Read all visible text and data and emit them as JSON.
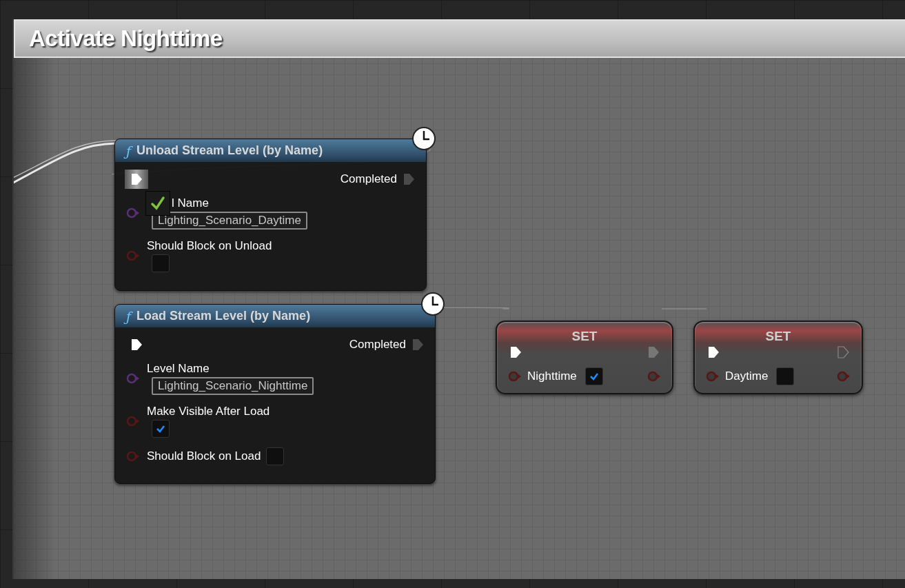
{
  "comment": {
    "title": "Activate Nighttime"
  },
  "nodes": [
    {
      "kind": "function",
      "icon": "ƒ",
      "title": "Unload Stream Level (by Name)",
      "latent": true,
      "exec_in_highlighted": true,
      "exec_out": "Completed",
      "drop_marker": true,
      "pins": [
        {
          "kind": "string",
          "label": "l Name",
          "value": "Lighting_Scenario_Daytime"
        },
        {
          "kind": "bool",
          "label": "Should Block on Unload",
          "checked": false,
          "inline": false
        }
      ]
    },
    {
      "kind": "function",
      "icon": "ƒ",
      "title": "Load Stream Level (by Name)",
      "latent": true,
      "exec_in_highlighted": false,
      "exec_out": "Completed",
      "pins": [
        {
          "kind": "string",
          "label": "Level Name",
          "value": "Lighting_Scenario_Nighttime"
        },
        {
          "kind": "bool",
          "label": "Make Visible After Load",
          "checked": true,
          "inline": false
        },
        {
          "kind": "bool",
          "label": "Should Block on Load",
          "checked": false,
          "inline": true
        }
      ]
    },
    {
      "kind": "set",
      "title": "SET",
      "exec_out_linked": true,
      "pins": [
        {
          "kind": "bool",
          "label": "Nighttime",
          "checked": true
        }
      ]
    },
    {
      "kind": "set",
      "title": "SET",
      "exec_out_linked": false,
      "pins": [
        {
          "kind": "bool",
          "label": "Daytime",
          "checked": false
        }
      ]
    }
  ]
}
